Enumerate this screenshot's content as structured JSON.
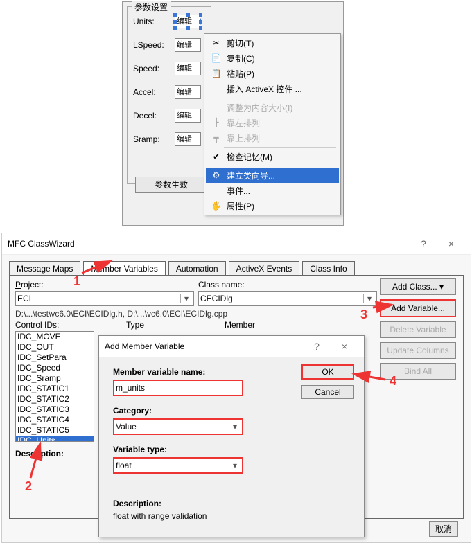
{
  "param_panel": {
    "title": "参数设置",
    "rows": [
      {
        "label": "Units:",
        "btn": "编辑"
      },
      {
        "label": "LSpeed:",
        "btn": "编辑"
      },
      {
        "label": "Speed:",
        "btn": "编辑"
      },
      {
        "label": "Accel:",
        "btn": "编辑"
      },
      {
        "label": "Decel:",
        "btn": "编辑"
      },
      {
        "label": "Sramp:",
        "btn": "编辑"
      }
    ],
    "apply_btn": "参数生效"
  },
  "context_menu": {
    "items": [
      {
        "icon": "✂",
        "label": "剪切(T)"
      },
      {
        "icon": "📄",
        "label": "复制(C)"
      },
      {
        "icon": "📋",
        "label": "粘贴(P)"
      },
      {
        "icon": "",
        "label": "插入 ActiveX 控件  ...",
        "sep_after": true
      },
      {
        "icon": "",
        "label": "调整为内容大小(I)",
        "disabled": true
      },
      {
        "icon": "┣",
        "label": "靠左排列",
        "disabled": true
      },
      {
        "icon": "┳",
        "label": "靠上排列",
        "disabled": true,
        "sep_after": true
      },
      {
        "icon": "✔",
        "label": "检查记忆(M)",
        "sep_after": true
      },
      {
        "icon": "⚙",
        "label": "建立类向导...",
        "highlight": true
      },
      {
        "icon": "",
        "label": "事件..."
      },
      {
        "icon": "🖐",
        "label": "属性(P)"
      }
    ]
  },
  "wizard": {
    "title": "MFC ClassWizard",
    "tabs": [
      "Message Maps",
      "Member Variables",
      "Automation",
      "ActiveX Events",
      "Class Info"
    ],
    "active_tab": 1,
    "project_label": "Project:",
    "project_value": "ECI",
    "class_label": "Class name:",
    "class_value": "CECIDlg",
    "path": "D:\\...\\test\\vc6.0\\ECI\\ECIDlg.h, D:\\...\\vc6.0\\ECI\\ECIDlg.cpp",
    "controls_label": "Control IDs:",
    "col_type": "Type",
    "col_member": "Member",
    "control_ids": [
      "IDC_MOVE",
      "IDC_OUT",
      "IDC_SetPara",
      "IDC_Speed",
      "IDC_Sramp",
      "IDC_STATIC1",
      "IDC_STATIC2",
      "IDC_STATIC3",
      "IDC_STATIC4",
      "IDC_STATIC5",
      "IDC_Units"
    ],
    "selected_id": 10,
    "description_label": "Description:",
    "buttons": {
      "add_class": "Add Class...",
      "add_var": "Add Variable...",
      "del_var": "Delete Variable",
      "upd_cols": "Update Columns",
      "bind_all": "Bind All"
    },
    "cancel": "取消"
  },
  "add_dlg": {
    "title": "Add Member Variable",
    "var_label": "Member variable name:",
    "var_value": "m_units",
    "cat_label": "Category:",
    "cat_value": "Value",
    "type_label": "Variable type:",
    "type_value": "float",
    "desc_label": "Description:",
    "desc_value": "float with range validation",
    "ok": "OK",
    "cancel": "Cancel"
  },
  "annotations": {
    "n1": "1",
    "n2": "2",
    "n3": "3",
    "n4": "4"
  }
}
